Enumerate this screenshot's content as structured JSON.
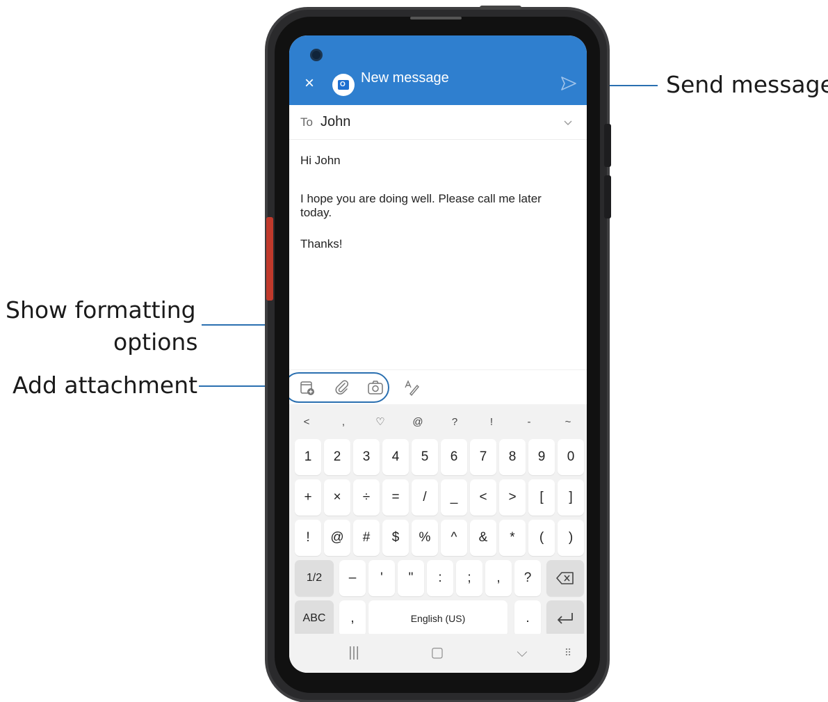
{
  "callouts": {
    "send_message": "Send message",
    "show_formatting_line1": "Show formatting",
    "show_formatting_line2": "options",
    "add_attachment": "Add attachment"
  },
  "app": {
    "title": "New message",
    "accent_color": "#2f7fcf",
    "to_label": "To",
    "to_value": "John",
    "subject": "Hi John",
    "body": "I hope you are doing well. Please call me later today.",
    "signoff": "Thanks!"
  },
  "toolbar": {
    "icons": [
      "attach-file-icon",
      "paperclip-icon",
      "camera-icon",
      "format-text-icon"
    ]
  },
  "keyboard": {
    "symbol_bar": [
      "<",
      ",",
      "♡",
      "@",
      "?",
      "!",
      "-",
      "~"
    ],
    "row1": [
      "1",
      "2",
      "3",
      "4",
      "5",
      "6",
      "7",
      "8",
      "9",
      "0"
    ],
    "row2": [
      "+",
      "×",
      "÷",
      "=",
      "/",
      "_",
      "<",
      ">",
      "[",
      "]"
    ],
    "row3": [
      "!",
      "@",
      "#",
      "$",
      "%",
      "^",
      "&",
      "*",
      "(",
      ")"
    ],
    "row4_page": "1/2",
    "row4": [
      "–",
      "'",
      "\"",
      ":",
      ";",
      ",",
      "?"
    ],
    "abc": "ABC",
    "comma": ",",
    "space": "English (US)",
    "period": "."
  },
  "nav": {
    "recents": "|||",
    "home": "▢",
    "back": "⌵",
    "keyboard": "⠿"
  }
}
